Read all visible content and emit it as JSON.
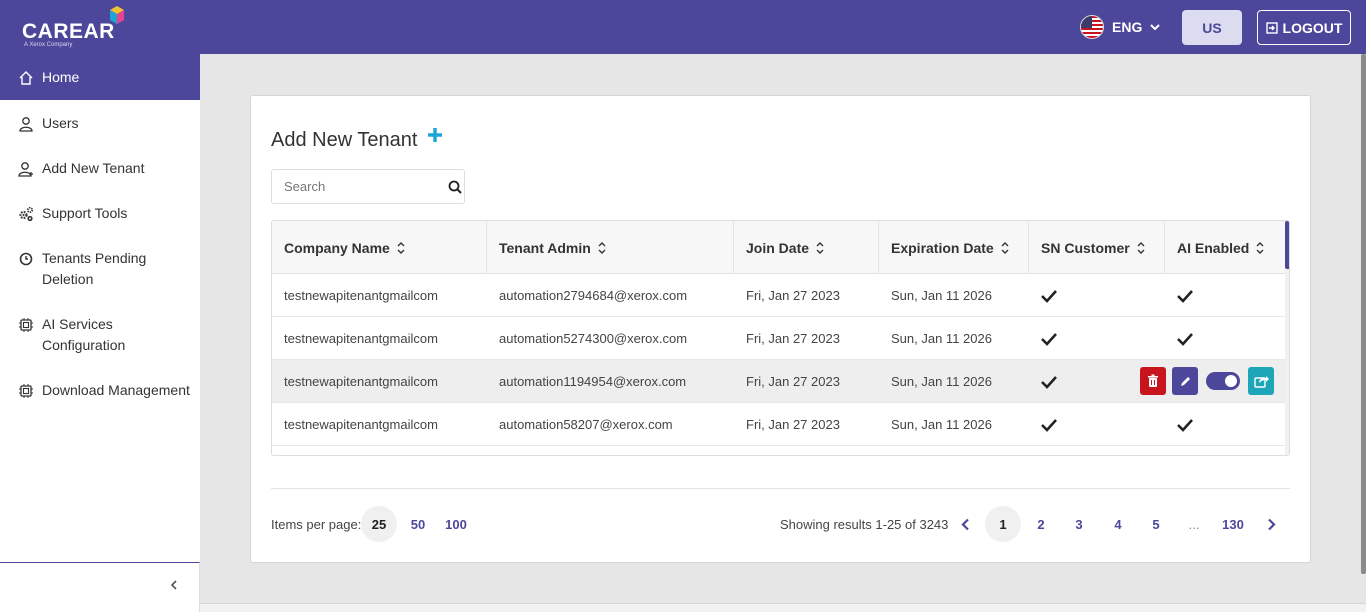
{
  "brand": {
    "name": "CAREAR",
    "tagline": "A Xerox Company"
  },
  "header": {
    "language": "ENG",
    "region_button": "US",
    "logout_label": "LOGOUT"
  },
  "sidebar": {
    "items": [
      {
        "label": "Home",
        "icon": "home-icon",
        "active": true
      },
      {
        "label": "Users",
        "icon": "user-icon"
      },
      {
        "label": "Add New Tenant",
        "icon": "add-user-icon"
      },
      {
        "label": "Support Tools",
        "icon": "gears-icon"
      },
      {
        "label": "Tenants Pending Deletion",
        "icon": "clock-icon"
      },
      {
        "label": "AI Services Configuration",
        "icon": "chip-icon"
      },
      {
        "label": "Download Management",
        "icon": "chip-icon"
      }
    ]
  },
  "main": {
    "title": "Add New Tenant",
    "search_placeholder": "Search",
    "columns": [
      "Company Name",
      "Tenant Admin",
      "Join Date",
      "Expiration Date",
      "SN Customer",
      "AI Enabled"
    ],
    "rows": [
      {
        "company": "testnewapitenantgmailcom",
        "admin": "automation2794684@xerox.com",
        "join": "Fri, Jan 27 2023",
        "expiration": "Sun, Jan 11 2026",
        "sn_customer": true,
        "ai_enabled": true
      },
      {
        "company": "testnewapitenantgmailcom",
        "admin": "automation5274300@xerox.com",
        "join": "Fri, Jan 27 2023",
        "expiration": "Sun, Jan 11 2026",
        "sn_customer": true,
        "ai_enabled": true
      },
      {
        "company": "testnewapitenantgmailcom",
        "admin": "automation1194954@xerox.com",
        "join": "Fri, Jan 27 2023",
        "expiration": "Sun, Jan 11 2026",
        "sn_customer": true,
        "ai_enabled": true,
        "hovered": true
      },
      {
        "company": "testnewapitenantgmailcom",
        "admin": "automation58207@xerox.com",
        "join": "Fri, Jan 27 2023",
        "expiration": "Sun, Jan 11 2026",
        "sn_customer": true,
        "ai_enabled": true
      }
    ],
    "row_actions": [
      "trash-icon",
      "pencil-icon",
      "toggle",
      "share-icon"
    ],
    "pagination": {
      "items_per_page_label": "Items per page:",
      "items_per_page_options": [
        "25",
        "50",
        "100"
      ],
      "selected_per_page": "25",
      "results_text": "Showing results 1-25 of 3243",
      "pages": [
        "1",
        "2",
        "3",
        "4",
        "5",
        "...",
        "130"
      ],
      "current_page": "1"
    }
  },
  "colors": {
    "primary": "#4d479b",
    "delete": "#c8141d",
    "share": "#1ea5b8",
    "plus": "#1ea5d8"
  }
}
